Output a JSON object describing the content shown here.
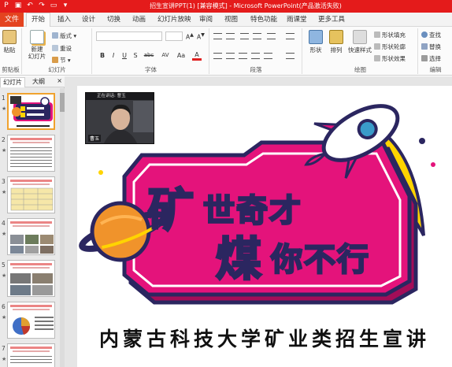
{
  "titlebar": {
    "title": "招生宣讲PPT(1) [兼容模式] - Microsoft PowerPoint(产品激活失败)",
    "bg_color": "#e41b1b"
  },
  "quick_access": [
    "powerpoint-app-icon",
    "save-icon",
    "undo-icon",
    "redo-icon",
    "start-show-icon",
    "qat-dropdown-icon"
  ],
  "tabs": {
    "file": "文件",
    "items": [
      "开始",
      "插入",
      "设计",
      "切换",
      "动画",
      "幻灯片放映",
      "审阅",
      "视图",
      "特色功能",
      "雨课堂",
      "更多工具"
    ],
    "active": "开始"
  },
  "ribbon": {
    "clipboard": {
      "paste": "粘贴",
      "label": "剪贴板"
    },
    "slides": {
      "new_slide": "新建\n幻灯片",
      "layout": "版式",
      "reset": "重设",
      "section": "节",
      "label": "幻灯片"
    },
    "font": {
      "label": "字体",
      "bold": "B",
      "italic": "I",
      "underline": "U",
      "shadow": "S",
      "strike": "abc",
      "spacing": "AV",
      "case": "Aa",
      "color": "A"
    },
    "paragraph": {
      "label": "段落"
    },
    "drawing": {
      "shapes": "形状",
      "arrange": "排列",
      "quick_styles": "快速样式",
      "shape_fill": "形状填充",
      "shape_outline": "形状轮廓",
      "shape_effects": "形状效果",
      "label": "绘图"
    },
    "editing": {
      "find": "查找",
      "replace": "替换",
      "select": "选择",
      "label": "编辑"
    }
  },
  "left_panel": {
    "tab_slides": "幻灯片",
    "tab_outline": "大纲",
    "close": "×",
    "thumbnails": [
      {
        "num": "1",
        "active": true
      },
      {
        "num": "2",
        "active": false
      },
      {
        "num": "3",
        "active": false
      },
      {
        "num": "4",
        "active": false
      },
      {
        "num": "5",
        "active": false
      },
      {
        "num": "6",
        "active": false
      },
      {
        "num": "7",
        "active": false
      }
    ]
  },
  "slide": {
    "video_overlay": {
      "top_text": "正在讲话: 曹玉",
      "name": "曹玉"
    },
    "logo": {
      "word1_a": "矿",
      "word1_b": "世奇才",
      "word2_a": "煤",
      "word2_b": "你不行"
    },
    "caption": "内蒙古科技大学矿业类招生宣讲",
    "colors": {
      "banner": "#e4137b",
      "banner_dark": "#a30d58",
      "yellow": "#ffd400",
      "navy": "#2b2660",
      "teal": "#3a9bc9"
    }
  }
}
